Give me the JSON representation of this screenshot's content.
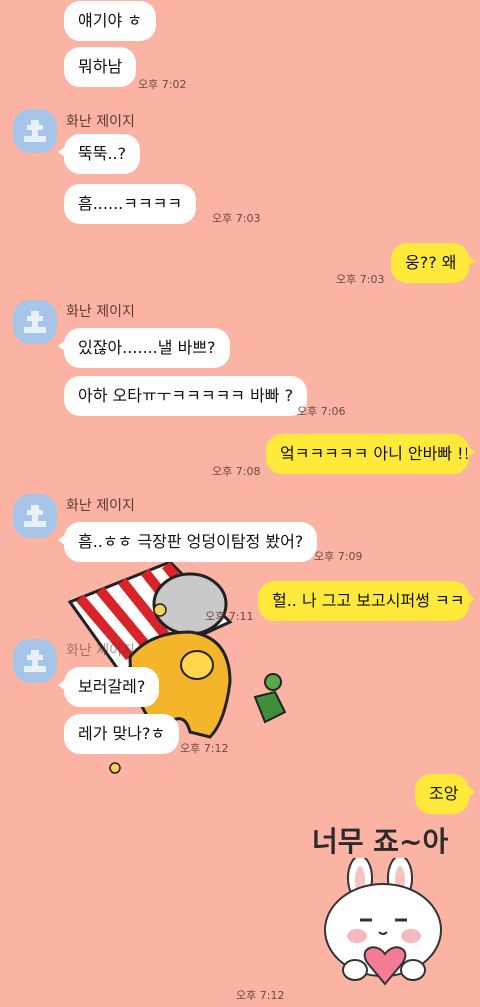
{
  "sender_name": "화난 제이지",
  "messages": {
    "m1": "얘기야 ㅎ",
    "m2": "뭐하남",
    "t1": "오후 7:02",
    "m3": "뚝뚝..?",
    "m4": "흠......ㅋㅋㅋㅋ",
    "t2": "오후 7:03",
    "m5": "웅?? 왜",
    "t3": "오후 7:03",
    "m6": "있잖아.......낼 바쁘?",
    "m7": "아하 오타ㅠㅜㅋㅋㅋㅋㅋ 바빠 ?",
    "t4": "오후 7:06",
    "m8": "엌ㅋㅋㅋㅋㅋ 아니 안바빠 !!",
    "t5": "오후 7:08",
    "m9": "흠..ㅎㅎ 극장판 엉덩이탐정 봤어?",
    "t6": "오후 7:09",
    "m10": "헐.. 나 그고 보고시퍼썽 ㅋㅋ",
    "t7": "오후 7:11",
    "m11": "보러갈레?",
    "m12": "레가 맞나?ㅎ",
    "t8": "오후 7:12",
    "m13": "조앙",
    "t9": "오후 7:12"
  },
  "sticker_caption": "너무 죠~아",
  "colors": {
    "background": "#fbb3a4",
    "incoming_bubble": "#ffffff",
    "outgoing_bubble": "#ffe93b",
    "avatar": "#a6c5e9"
  }
}
